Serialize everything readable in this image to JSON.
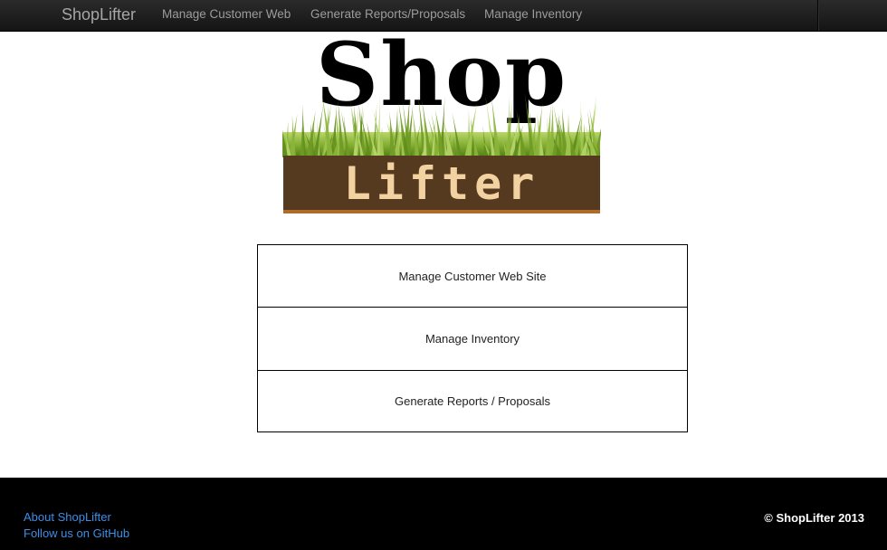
{
  "navbar": {
    "brand": "ShopLifter",
    "links": [
      "Manage Customer Web",
      "Generate Reports/Proposals",
      "Manage Inventory"
    ]
  },
  "logo": {
    "line1": "Shop",
    "line2": "Lifter"
  },
  "actions": [
    "Manage Customer Web Site",
    "Manage Inventory",
    "Generate Reports / Proposals"
  ],
  "footer": {
    "links": [
      "About ShopLifter",
      "Follow us on GitHub"
    ],
    "copyright": "© ShopLifter 2013",
    "link_color": "#3d8ee6"
  }
}
